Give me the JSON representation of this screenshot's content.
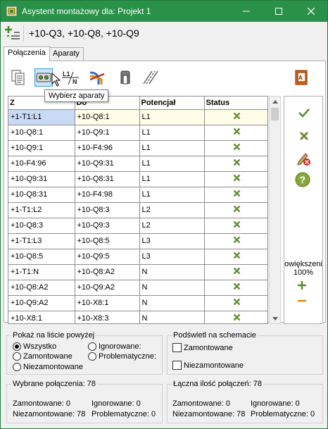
{
  "window": {
    "title": "Asystent montażowy dla: Projekt 1"
  },
  "header": {
    "devices_text": "+10-Q3, +10-Q8, +10-Q9",
    "icon": "add-remove-icon"
  },
  "tabs": [
    {
      "label": "Połączenia",
      "active": true
    },
    {
      "label": "Aparaty",
      "active": false
    }
  ],
  "toolbar": {
    "tools": [
      "document-icon",
      "select-devices-icon",
      "line-section-icon",
      "wire-color-icon",
      "terminal-icon",
      "hatch-icon",
      "book-icon"
    ],
    "tooltip": "Wybierz aparaty"
  },
  "grid": {
    "columns": [
      "Z",
      "Do",
      "Potencjał",
      "Status"
    ],
    "rows": [
      {
        "from": "+1-T1:L1",
        "to": "+10-Q8:1",
        "potential": "L1",
        "status": "x-icon"
      },
      {
        "from": "+10-Q8:1",
        "to": "+10-Q9:1",
        "potential": "L1",
        "status": "x-icon"
      },
      {
        "from": "+10-Q9:1",
        "to": "+10-F4:96",
        "potential": "L1",
        "status": "x-icon"
      },
      {
        "from": "+10-F4:96",
        "to": "+10-Q9:31",
        "potential": "L1",
        "status": "x-icon"
      },
      {
        "from": "+10-Q9:31",
        "to": "+10-Q8:31",
        "potential": "L1",
        "status": "x-icon"
      },
      {
        "from": "+10-Q8:31",
        "to": "+10-F4:98",
        "potential": "L1",
        "status": "x-icon"
      },
      {
        "from": "+1-T1:L2",
        "to": "+10-Q8:3",
        "potential": "L2",
        "status": "x-icon"
      },
      {
        "from": "+10-Q8:3",
        "to": "+10-Q9:3",
        "potential": "L2",
        "status": "x-icon"
      },
      {
        "from": "+1-T1:L3",
        "to": "+10-Q8:5",
        "potential": "L3",
        "status": "x-icon"
      },
      {
        "from": "+10-Q8:5",
        "to": "+10-Q9:5",
        "potential": "L3",
        "status": "x-icon"
      },
      {
        "from": "+1-T1:N",
        "to": "+10-Q8:A2",
        "potential": "N",
        "status": "x-icon"
      },
      {
        "from": "+10-Q8:A2",
        "to": "+10-Q9:A2",
        "potential": "N",
        "status": "x-icon"
      },
      {
        "from": "+10-Q9:A2",
        "to": "+10-X8:1",
        "potential": "N",
        "status": "x-icon"
      },
      {
        "from": "+10-X8:1",
        "to": "+10-X8:3",
        "potential": "N",
        "status": "x-icon"
      }
    ]
  },
  "right_pane": {
    "icons": [
      "check-icon",
      "x-icon",
      "pencil-delete-icon",
      "help-icon",
      "plus-icon",
      "minus-icon"
    ],
    "zoom_label": "owiększeni",
    "zoom_value": "100%"
  },
  "show_group": {
    "title": "Pokaż na liście powyżej",
    "options": [
      "Wszystko",
      "Ignorowane:",
      "Zamontowane",
      "Problematyczne:",
      "Niezamontowane"
    ],
    "selected": "Wszystko"
  },
  "highlight_group": {
    "title": "Podświetl na schemacie",
    "options": [
      "Zamontowane",
      "Niezamontowane"
    ]
  },
  "selected_stats": {
    "title": "Wybrane połączenia: 78",
    "mounted": "Zamontowane: 0",
    "ignored": "Ignorowane: 0",
    "unmounted": "Niezamontowane: 78",
    "problematic": "Problematyczne: 0"
  },
  "total_stats": {
    "title": "Łączna ilość połączeń: 78",
    "mounted": "Zamontowane: 0",
    "ignored": "Ignorowane: 0",
    "unmounted": "Niezamontowane: 78",
    "problematic": "Problematyczne: 0"
  },
  "colors": {
    "titlebar": "#2a9148",
    "accent": "#3c9ddb",
    "x_icon": "#6b8f3a",
    "check_icon": "#5a8f2a"
  }
}
